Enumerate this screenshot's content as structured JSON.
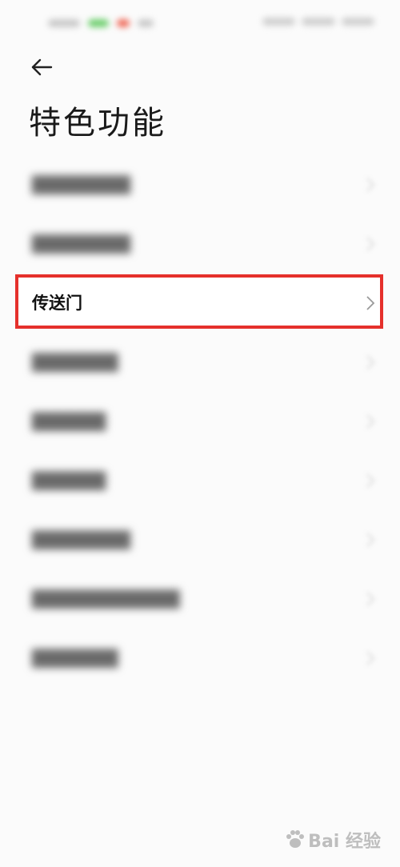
{
  "header": {
    "title": "特色功能"
  },
  "list": {
    "items": [
      {
        "label": "████████",
        "state": "blurred"
      },
      {
        "label": "████████",
        "state": "blurred"
      },
      {
        "label": "传送门",
        "state": "visible"
      },
      {
        "label": "███████",
        "state": "blurred"
      },
      {
        "label": "██████",
        "state": "blurred"
      },
      {
        "label": "██████",
        "state": "blurred"
      },
      {
        "label": "████████",
        "state": "blurred"
      },
      {
        "label": "████████████",
        "state": "blurred"
      },
      {
        "label": "███████",
        "state": "blurred"
      }
    ]
  },
  "highlight": {
    "color": "#e5302b"
  },
  "watermark": {
    "text": "Bai 经验"
  }
}
